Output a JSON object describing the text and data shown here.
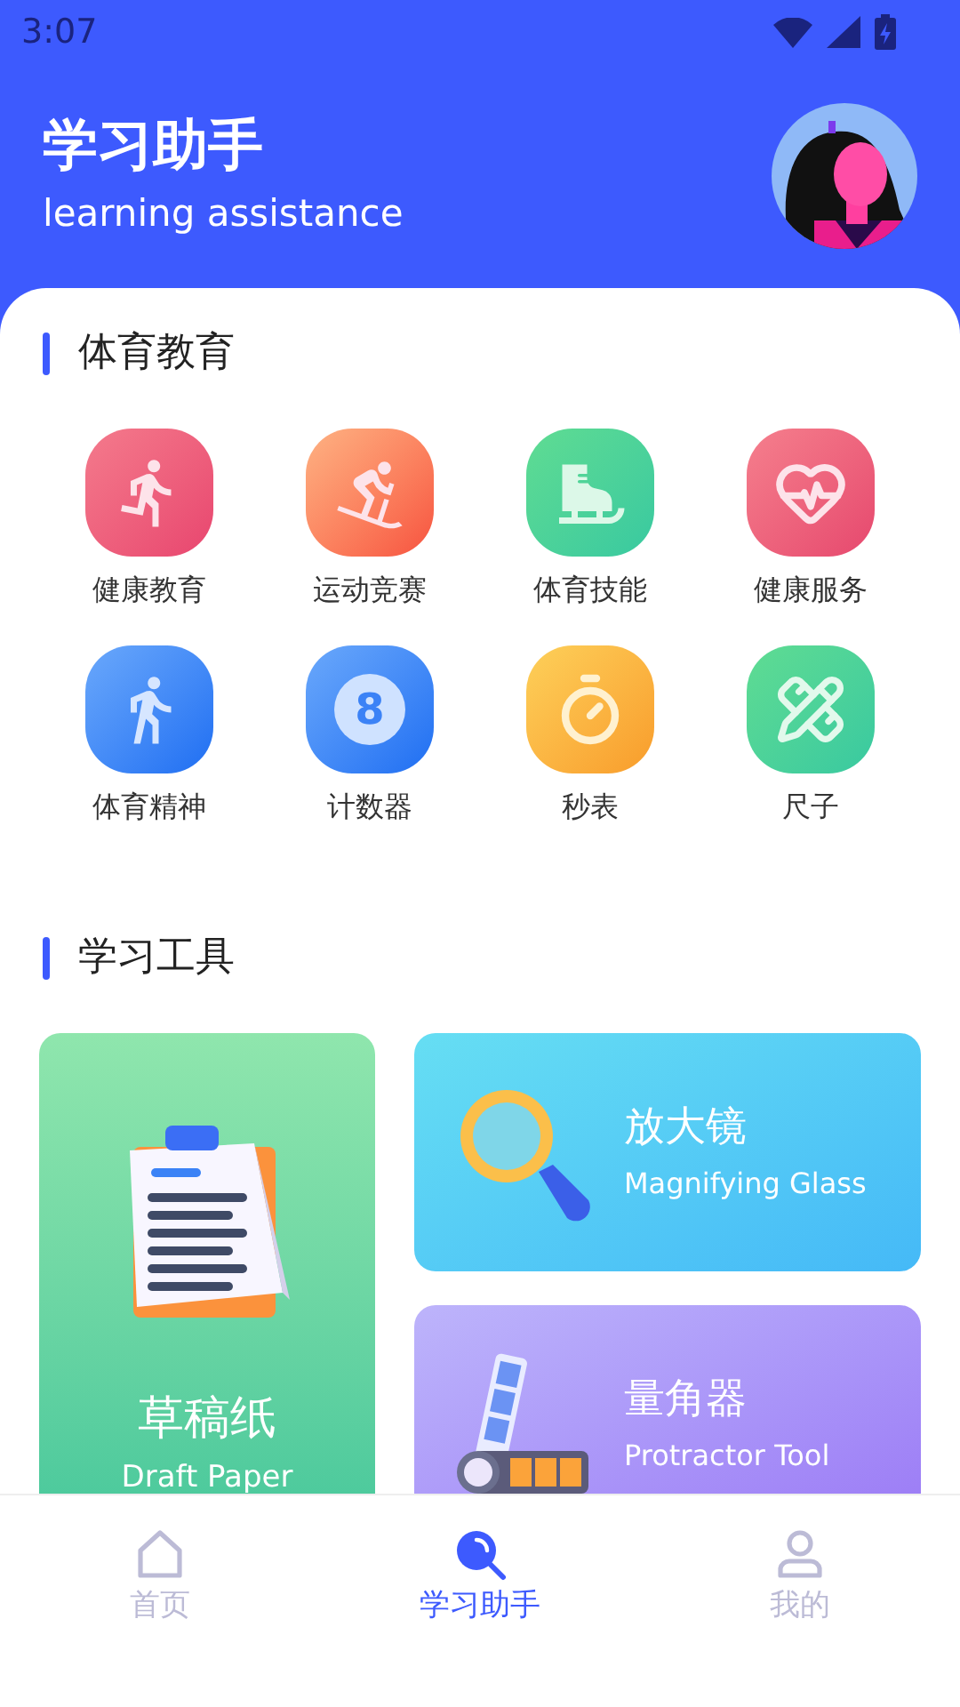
{
  "status_bar": {
    "time": "3:07"
  },
  "header": {
    "title": "学习助手",
    "subtitle": "learning assistance"
  },
  "sections": [
    {
      "title": "体育教育",
      "items": [
        {
          "label": "健康教育",
          "kind": "run"
        },
        {
          "label": "运动竞赛",
          "kind": "ski"
        },
        {
          "label": "体育技能",
          "kind": "skate"
        },
        {
          "label": "健康服务",
          "kind": "heart"
        },
        {
          "label": "体育精神",
          "kind": "walk"
        },
        {
          "label": "计数器",
          "kind": "ball",
          "glyph": "8"
        },
        {
          "label": "秒表",
          "kind": "timer"
        },
        {
          "label": "尺子",
          "kind": "ruler"
        }
      ]
    },
    {
      "title": "学习工具",
      "cards": [
        {
          "title": "草稿纸",
          "subtitle": "Draft Paper",
          "kind": "paper"
        },
        {
          "title": "放大镜",
          "subtitle": "Magnifying Glass",
          "kind": "magnifier"
        },
        {
          "title": "量角器",
          "subtitle": "Protractor Tool",
          "kind": "protractor"
        }
      ]
    }
  ],
  "tabs": [
    {
      "label": "首页",
      "kind": "home",
      "selected": false
    },
    {
      "label": "学习助手",
      "kind": "search",
      "selected": true
    },
    {
      "label": "我的",
      "kind": "profile",
      "selected": false
    }
  ]
}
